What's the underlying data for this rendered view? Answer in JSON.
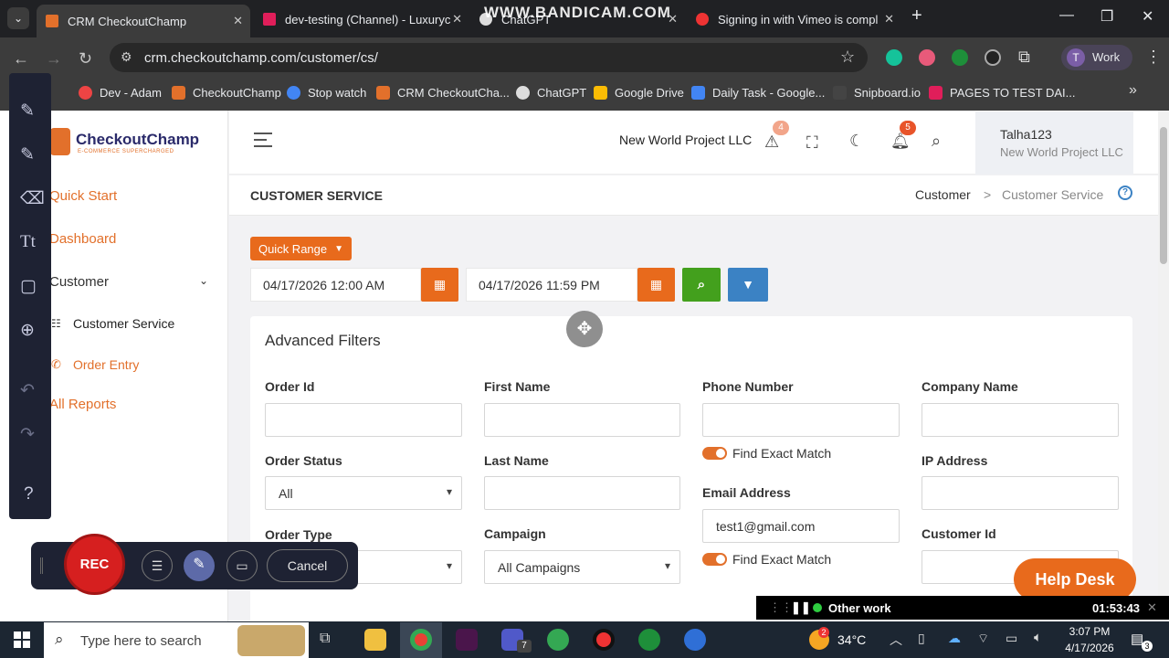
{
  "browser": {
    "tabs": [
      {
        "title": "CRM CheckoutChamp",
        "active": true
      },
      {
        "title": "dev-testing (Channel) - Luxuryc"
      },
      {
        "title": "ChatGPT"
      },
      {
        "title": "Signing in with Vimeo is compl"
      }
    ],
    "watermark": "WWW.BANDICAM.COM",
    "url": "crm.checkoutchamp.com/customer/cs/",
    "profile_initial": "T",
    "profile_label": "Work",
    "bookmarks": [
      "Dev - Adam",
      "CheckoutChamp",
      "Stop watch",
      "CRM CheckoutCha...",
      "ChatGPT",
      "Google Drive",
      "Daily Task - Google...",
      "Snipboard.io",
      "PAGES TO TEST DAI..."
    ]
  },
  "sidebar": {
    "logo_name": "CheckoutChamp",
    "logo_tagline": "E-COMMERCE SUPERCHARGED",
    "items": [
      {
        "label": "Quick Start"
      },
      {
        "label": "Dashboard"
      },
      {
        "label": "Customer"
      },
      {
        "label": "Customer Service"
      },
      {
        "label": "Order Entry"
      },
      {
        "label": "All Reports"
      }
    ]
  },
  "header": {
    "company": "New World Project LLC",
    "alert_count": "4",
    "notif_count": "5",
    "user_name": "Talha123",
    "user_company": "New World Project LLC"
  },
  "page": {
    "title": "CUSTOMER SERVICE",
    "breadcrumb_parent": "Customer",
    "breadcrumb_sep": ">",
    "breadcrumb_current": "Customer Service"
  },
  "filters": {
    "quick_range": "Quick Range",
    "start_date": "04/17/2026 12:00 AM",
    "end_date": "04/17/2026 11:59 PM",
    "card_title": "Advanced Filters",
    "order_id": "Order Id",
    "first_name": "First Name",
    "phone_number": "Phone Number",
    "company_name": "Company Name",
    "find_exact_1": "Find Exact Match",
    "order_status": "Order Status",
    "order_status_value": "All",
    "last_name": "Last Name",
    "ip_address": "IP Address",
    "email_address": "Email Address",
    "email_value": "test1@gmail.com",
    "order_type": "Order Type",
    "campaign": "Campaign",
    "campaign_value": "All Campaigns",
    "customer_id": "Customer Id",
    "find_exact_2": "Find Exact Match"
  },
  "overlays": {
    "rec_label": "REC",
    "cancel_label": "Cancel",
    "help_desk": "Help Desk",
    "timer_label": "Other work",
    "timer_value": "01:53:43"
  },
  "taskbar": {
    "search_placeholder": "Type here to search",
    "weather": "34°C",
    "time": "3:07 PM",
    "date": "4/17/2026",
    "chrome_badge": "7",
    "weather_badge": "2",
    "notif_count": "3"
  },
  "colors": {
    "brand_orange": "#e86a1c",
    "search_green": "#43a01d",
    "filter_blue": "#3b82c4"
  }
}
